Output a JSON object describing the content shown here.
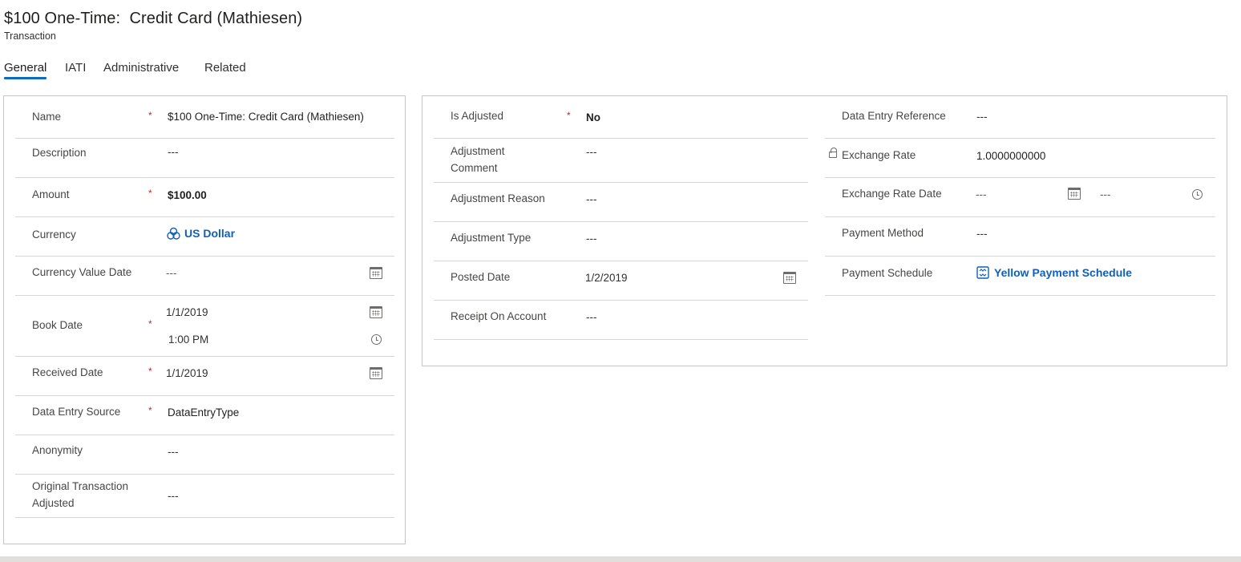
{
  "header": {
    "title": "$100 One-Time:  Credit Card (Mathiesen)",
    "subtitle": "Transaction"
  },
  "tabs": [
    {
      "label": "General",
      "active": true
    },
    {
      "label": "IATI",
      "active": false
    },
    {
      "label": "Administrative",
      "active": false
    },
    {
      "label": "Related",
      "active": false
    }
  ],
  "required_marker": "*",
  "section1": {
    "name": {
      "label": "Name",
      "value": "$100 One-Time:  Credit Card (Mathiesen)"
    },
    "description": {
      "label": "Description",
      "value": "---"
    },
    "amount": {
      "label": "Amount",
      "value": "$100.00"
    },
    "currency": {
      "label": "Currency",
      "value": "US Dollar",
      "icon": "currency-icon"
    },
    "currency_value_date": {
      "label": "Currency Value Date",
      "value": "---",
      "icon": "calendar-icon"
    },
    "book_date": {
      "label": "Book Date",
      "date": "1/1/2019",
      "time": "1:00 PM"
    },
    "received_date": {
      "label": "Received Date",
      "value": "1/1/2019"
    },
    "data_entry_source": {
      "label": "Data Entry Source",
      "value": "DataEntryType"
    },
    "anonymity": {
      "label": "Anonymity",
      "value": "---"
    },
    "original_transaction_adjusted": {
      "label": "Original Transaction Adjusted",
      "value": "---"
    }
  },
  "section2": {
    "is_adjusted": {
      "label": "Is Adjusted",
      "value": "No"
    },
    "adjustment_comment": {
      "label": "Adjustment Comment",
      "value": "---"
    },
    "adjustment_reason": {
      "label": "Adjustment Reason",
      "value": "---"
    },
    "adjustment_type": {
      "label": "Adjustment Type",
      "value": "---"
    },
    "posted_date": {
      "label": "Posted Date",
      "value": "1/2/2019"
    },
    "receipt_on_account": {
      "label": "Receipt On Account",
      "value": "---"
    },
    "data_entry_reference": {
      "label": "Data Entry Reference",
      "value": "---"
    },
    "exchange_rate": {
      "label": "Exchange Rate",
      "value": "1.0000000000",
      "locked": true
    },
    "exchange_rate_date": {
      "label": "Exchange Rate Date",
      "date": "---",
      "time": "---"
    },
    "payment_method": {
      "label": "Payment Method",
      "value": "---"
    },
    "payment_schedule": {
      "label": "Payment Schedule",
      "value": "Yellow Payment Schedule",
      "icon": "payment-schedule-icon"
    }
  },
  "colors": {
    "accent": "#0f6cbd",
    "link": "#1160b7",
    "required": "#c4262e",
    "divider": "#d8d6d4"
  }
}
